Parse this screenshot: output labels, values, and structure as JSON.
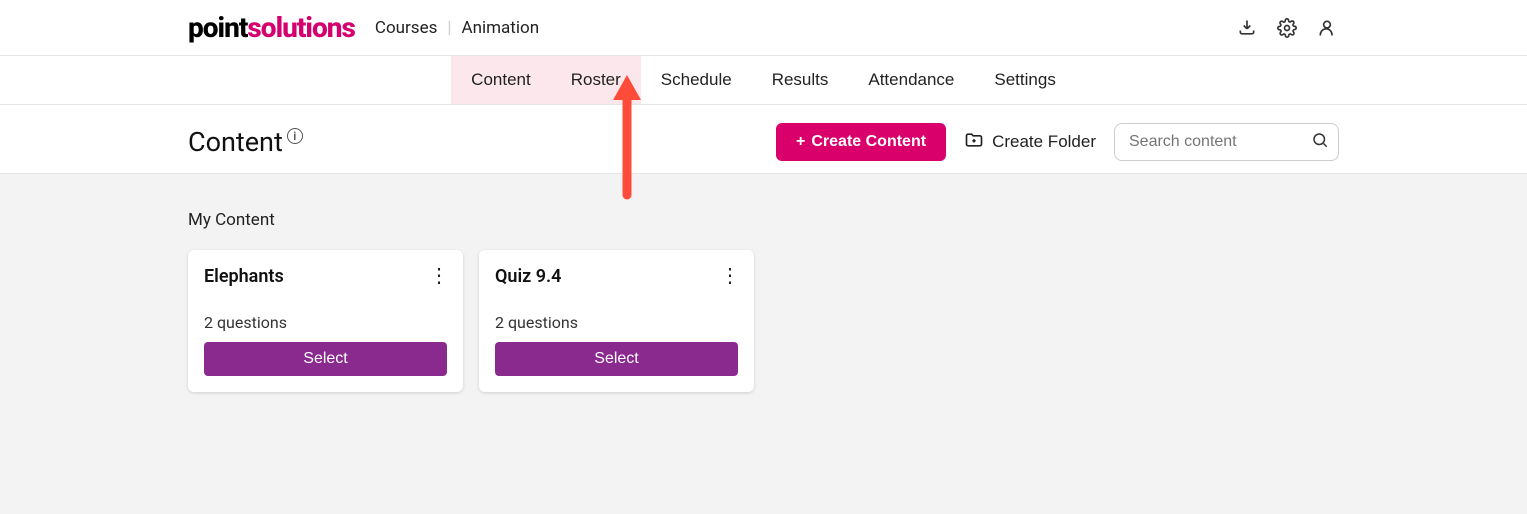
{
  "logo": {
    "part1": "point",
    "part2": "solutions"
  },
  "breadcrumb": {
    "courses": "Courses",
    "current": "Animation"
  },
  "tabs": [
    "Content",
    "Roster",
    "Schedule",
    "Results",
    "Attendance",
    "Settings"
  ],
  "page_title": "Content",
  "actions": {
    "create_content": "Create Content",
    "create_folder": "Create Folder"
  },
  "search": {
    "placeholder": "Search content"
  },
  "section_title": "My Content",
  "cards": [
    {
      "title": "Elephants",
      "subtitle": "2 questions",
      "button": "Select"
    },
    {
      "title": "Quiz 9.4",
      "subtitle": "2 questions",
      "button": "Select"
    }
  ]
}
